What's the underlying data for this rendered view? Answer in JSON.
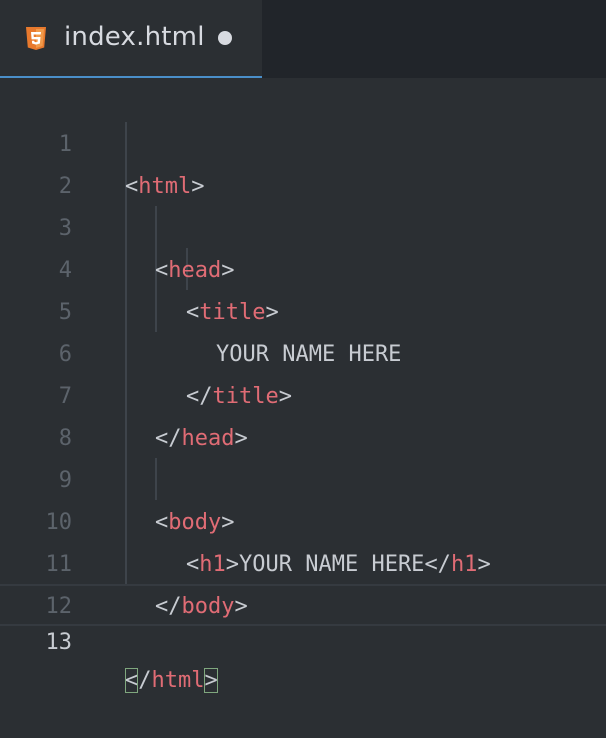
{
  "tab": {
    "icon": "html5-icon",
    "label": "index.html",
    "unsaved": true,
    "accent": "#4a8fc9"
  },
  "colors": {
    "tag": "#e06c75",
    "text": "#c8ccd2",
    "line_number": "#5c636b",
    "background": "#2b2f33"
  },
  "lines": [
    {
      "n": "1"
    },
    {
      "n": "2"
    },
    {
      "n": "3"
    },
    {
      "n": "4"
    },
    {
      "n": "5"
    },
    {
      "n": "6"
    },
    {
      "n": "7"
    },
    {
      "n": "8"
    },
    {
      "n": "9"
    },
    {
      "n": "10"
    },
    {
      "n": "11"
    },
    {
      "n": "12"
    },
    {
      "n": "13"
    }
  ],
  "code": {
    "l1": {
      "open": "<",
      "tag": "html",
      "close": ">"
    },
    "l3": {
      "open": "<",
      "tag": "head",
      "close": ">"
    },
    "l4": {
      "open": "<",
      "tag": "title",
      "close": ">"
    },
    "l5": {
      "text": "YOUR NAME HERE"
    },
    "l6": {
      "open": "</",
      "tag": "title",
      "close": ">"
    },
    "l7": {
      "open": "</",
      "tag": "head",
      "close": ">"
    },
    "l9": {
      "open": "<",
      "tag": "body",
      "close": ">"
    },
    "l10": {
      "open": "<",
      "tag": "h1",
      "mid": ">",
      "text": "YOUR NAME HERE",
      "open2": "</",
      "tag2": "h1",
      "close": ">"
    },
    "l11": {
      "open": "</",
      "tag": "body",
      "close": ">"
    },
    "l13": {
      "open": "<",
      "slash": "/",
      "tag": "html",
      "close": ">"
    }
  }
}
